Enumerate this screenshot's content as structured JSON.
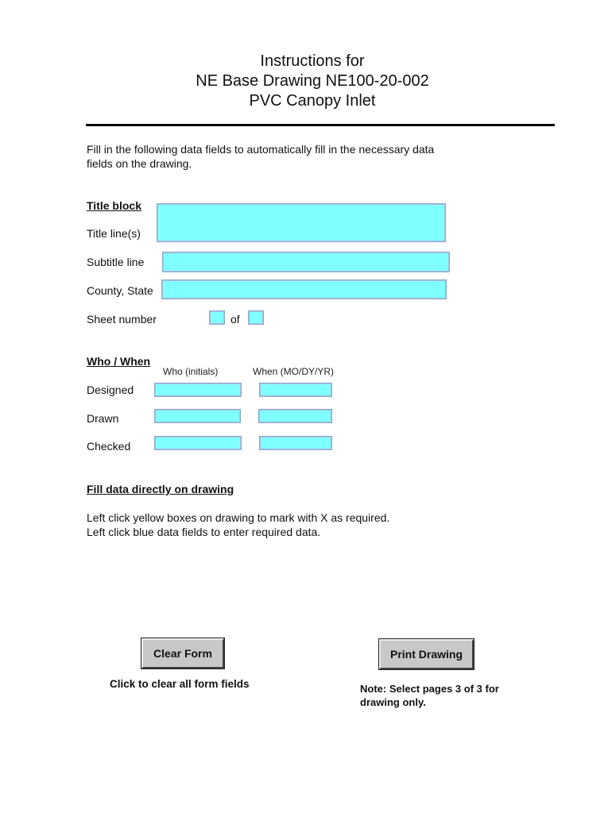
{
  "header": {
    "line1": "Instructions  for",
    "line2": "NE Base Drawing NE100-20-002",
    "line3": "PVC Canopy Inlet"
  },
  "intro": {
    "line1": "Fill in the following data fields to automatically fill in the necessary data",
    "line2": "fields on the drawing."
  },
  "title_block": {
    "heading": "Title block",
    "title_lines_label": "Title line(s)",
    "title_lines_value": "",
    "subtitle_label": "Subtitle line",
    "subtitle_value": "",
    "county_state_label": "County, State",
    "county_state_value": "",
    "sheet_number_label": "Sheet number",
    "sheet_number_value": "",
    "of_label": "of",
    "sheet_total_value": ""
  },
  "who_when": {
    "heading": "Who / When",
    "who_header": "Who (initials)",
    "when_header": "When (MO/DY/YR)",
    "rows": [
      {
        "label": "Designed",
        "who": "",
        "when": ""
      },
      {
        "label": "Drawn",
        "who": "",
        "when": ""
      },
      {
        "label": "Checked",
        "who": "",
        "when": ""
      }
    ]
  },
  "fill_direct": {
    "heading": "Fill data  directly on drawing",
    "line1": "Left click yellow boxes on drawing to mark with X as required.",
    "line2": "Left click blue data fields to enter required data."
  },
  "buttons": {
    "clear_label": "Clear Form",
    "clear_caption": "Click to clear all form fields",
    "print_label": "Print Drawing",
    "print_note_line1": "Note:  Select pages 3 of 3 for",
    "print_note_line2": "drawing only."
  },
  "colors": {
    "field_fill": "#80ffff",
    "field_border": "#8aa8d0",
    "button_face": "#c8c8c8"
  }
}
